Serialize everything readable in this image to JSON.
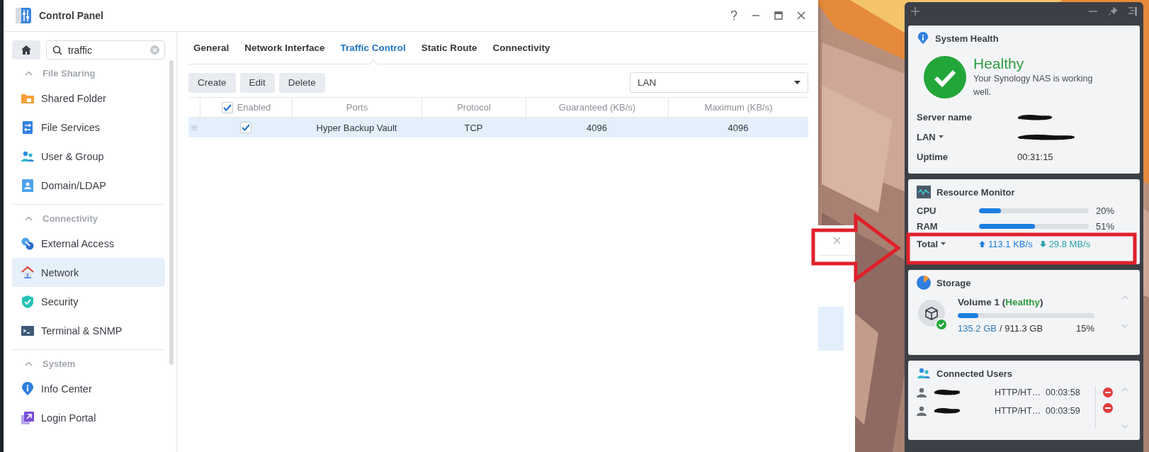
{
  "window": {
    "title": "Control Panel"
  },
  "sidebar": {
    "search": {
      "value": "traffic"
    },
    "groups": [
      {
        "title": "File Sharing",
        "expanded": true,
        "items": [
          {
            "label": "Shared Folder",
            "selected": false
          },
          {
            "label": "File Services",
            "selected": false
          },
          {
            "label": "User & Group",
            "selected": false
          },
          {
            "label": "Domain/LDAP",
            "selected": false
          }
        ]
      },
      {
        "title": "Connectivity",
        "expanded": true,
        "items": [
          {
            "label": "External Access",
            "selected": false
          },
          {
            "label": "Network",
            "selected": true
          },
          {
            "label": "Security",
            "selected": false
          },
          {
            "label": "Terminal & SNMP",
            "selected": false
          }
        ]
      },
      {
        "title": "System",
        "expanded": true,
        "items": [
          {
            "label": "Info Center",
            "selected": false
          },
          {
            "label": "Login Portal",
            "selected": false
          }
        ]
      }
    ]
  },
  "tabs": [
    {
      "label": "General",
      "selected": false
    },
    {
      "label": "Network Interface",
      "selected": false
    },
    {
      "label": "Traffic Control",
      "selected": true
    },
    {
      "label": "Static Route",
      "selected": false
    },
    {
      "label": "Connectivity",
      "selected": false
    }
  ],
  "toolbar": {
    "buttons": [
      "Create",
      "Edit",
      "Delete"
    ],
    "interface": {
      "value": "LAN"
    }
  },
  "table": {
    "columns": [
      "Enabled",
      "Ports",
      "Protocol",
      "Guaranteed (KB/s)",
      "Maximum (KB/s)"
    ],
    "header_checked": true,
    "rows": [
      {
        "enabled": true,
        "selected": true,
        "cells": [
          "",
          "Hyper Backup Vault",
          "TCP",
          "4096",
          "4096"
        ]
      }
    ]
  },
  "widgets": {
    "system_health": {
      "title": "System Health",
      "status": "Healthy",
      "message": "Your Synology NAS is working well.",
      "info": [
        {
          "label": "Server name",
          "dropdown": false,
          "redacted": true
        },
        {
          "label": "LAN",
          "dropdown": true,
          "redacted": true
        },
        {
          "label": "Uptime",
          "dropdown": false,
          "redacted": false,
          "value": "00:31:15"
        }
      ]
    },
    "resource_monitor": {
      "title": "Resource Monitor",
      "meters": [
        {
          "label": "CPU",
          "level": 0.2,
          "reading": "20%"
        },
        {
          "label": "RAM",
          "level": 0.51,
          "reading": "51%"
        }
      ],
      "network": {
        "label": "Total",
        "upload": "113.1 KB/s",
        "download": "29.8 MB/s"
      }
    },
    "storage": {
      "title": "Storage",
      "volume": {
        "name": "Volume 1 (**Healthy**)",
        "level": 0.15,
        "used": "135.2 GB",
        "total": "/ 911.3 GB",
        "percent": "15%"
      }
    },
    "connected_users": {
      "title": "Connected Users",
      "users": [
        {
          "protocol": "HTTP/HT…",
          "time": "00:03:58"
        },
        {
          "protocol": "HTTP/HT…",
          "time": "00:03:59"
        }
      ]
    }
  }
}
